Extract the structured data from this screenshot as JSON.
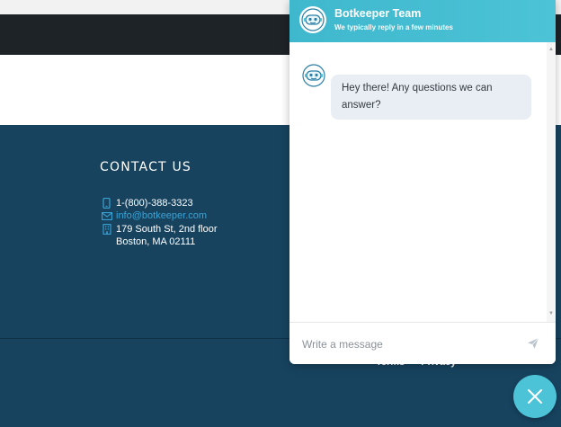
{
  "footer": {
    "contact_title": "CONTACT US",
    "phone": "1-(800)-388-3323",
    "email": "info@botkeeper.com",
    "address_line1": "179 South St, 2nd floor",
    "address_line2": "Boston, MA 02111",
    "bottom_links": [
      "Terms",
      "Privacy"
    ]
  },
  "chat": {
    "team_name": "Botkeeper Team",
    "reply_time": "We typically reply in a few minutes",
    "messages": [
      {
        "text": "Hey there! Any questions we can answer?"
      }
    ],
    "input_placeholder": "Write a message"
  },
  "colors": {
    "chat_accent": "#4cc3d6",
    "footer_bg": "#17435f",
    "link": "#3aa3d6",
    "topbar": "#1e2328"
  },
  "icons": {
    "phone": "phone-icon",
    "email": "envelope-icon",
    "address": "building-icon",
    "send": "send-icon",
    "close": "close-icon",
    "avatar": "bot-avatar-icon"
  }
}
